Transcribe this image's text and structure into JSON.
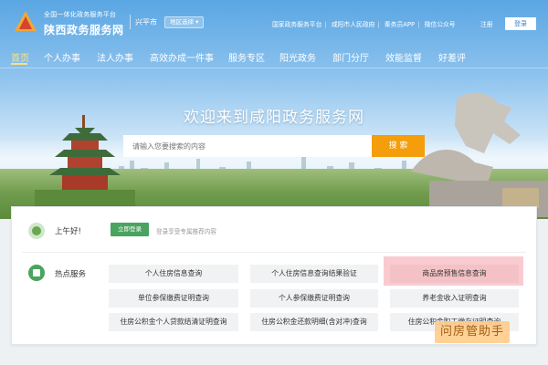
{
  "header": {
    "platform_label": "全国一体化政务服务平台",
    "site_name": "陕西政务服务网",
    "city": "兴平市",
    "region_button": "地区选择",
    "links": [
      "国家政务服务平台",
      "咸阳市人民政府",
      "秦务员APP",
      "微信公众号"
    ],
    "register": "注册",
    "login": "登录"
  },
  "nav": [
    "首页",
    "个人办事",
    "法人办事",
    "高效办成一件事",
    "服务专区",
    "阳光政务",
    "部门分厅",
    "效能监督",
    "好差评"
  ],
  "hero": {
    "welcome": "欢迎来到咸阳政务服务网",
    "search_placeholder": "请输入您要搜索的内容",
    "search_button": "搜 索"
  },
  "greeting": {
    "text": "上午好!",
    "login_button": "立即登录",
    "hint": "登录享受专属推荐内容"
  },
  "hot": {
    "label": "热点服务",
    "services": [
      "个人住房信息查询",
      "个人住房信息查询结果验证",
      "商品房预售信息查询",
      "单位参保缴费证明查询",
      "个人参保缴费证明查询",
      "养老金收入证明查询",
      "住房公积金个人贷款结清证明查询",
      "住房公积金还款明细(含对冲)查询",
      "住房公积金职工缴存证明查询"
    ]
  },
  "watermark": "问房管助手",
  "colors": {
    "accent": "#f59e0b",
    "green": "#4aa35f",
    "highlight": "#f4c2c6"
  }
}
